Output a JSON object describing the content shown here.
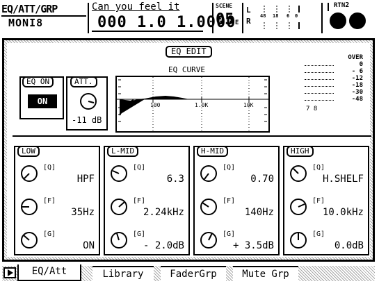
{
  "header": {
    "group_title": "EQ/ATT/GRP",
    "group_sub": "MONI8",
    "song_title": "Can you feel it",
    "song_counter": "000 1.0 1.0000",
    "scene_label": "SCENE",
    "scene_number": "05",
    "scene_suffix": "E",
    "meter_L": "L",
    "meter_R": "R",
    "meter_ticks": [
      "48",
      "18",
      "6",
      "0"
    ],
    "rtn_label": "RTN",
    "rtn_number": "2"
  },
  "panel": {
    "title": "EQ EDIT",
    "curve_label": "EQ CURVE",
    "curve_x_ticks": [
      "100",
      "1.0K",
      "10K"
    ],
    "eq_on_label": "EQ ON",
    "eq_on_button": "ON",
    "att_label": "ATT.",
    "att_value": "-11 dB",
    "over_meter": [
      "OVER",
      "0",
      "- 6",
      "-12",
      "-18",
      "-30",
      "-48"
    ],
    "meter_channels": "7  8"
  },
  "bands": [
    {
      "label": "LOW",
      "q_name": "[Q]",
      "q_value": "HPF",
      "f_name": "[F]",
      "f_value": "35Hz",
      "g_name": "[G]",
      "g_value": "ON"
    },
    {
      "label": "L-MID",
      "q_name": "[Q]",
      "q_value": "6.3",
      "f_name": "[F]",
      "f_value": "2.24kHz",
      "g_name": "[G]",
      "g_value": "- 2.0dB"
    },
    {
      "label": "H-MID",
      "q_name": "[Q]",
      "q_value": "0.70",
      "f_name": "[F]",
      "f_value": "140Hz",
      "g_name": "[G]",
      "g_value": "+ 3.5dB"
    },
    {
      "label": "HIGH",
      "q_name": "[Q]",
      "q_value": "H.SHELF",
      "f_name": "[F]",
      "f_value": "10.0kHz",
      "g_name": "[G]",
      "g_value": "0.0dB"
    }
  ],
  "tabs": [
    "EQ/Att",
    "Library",
    "FaderGrp",
    "Mute Grp"
  ],
  "colors": {
    "ink": "#000000",
    "paper": "#ffffff"
  }
}
